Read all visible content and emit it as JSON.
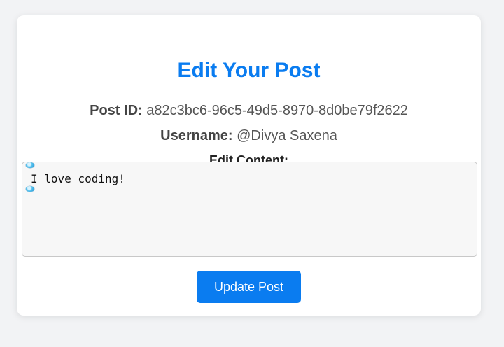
{
  "page": {
    "title": "Edit Your Post",
    "post_id_label": "Post ID:",
    "post_id": "a82c3bc6-96c5-49d5-8970-8d0be79f2622",
    "username_label": "Username:",
    "username": "@Divya Saxena",
    "edit_content_label": "Edit Content:",
    "content_value": "I love coding!",
    "update_button_label": "Update Post"
  },
  "colors": {
    "accent": "#0a7cf0",
    "background": "#f2f3f5",
    "card": "#ffffff",
    "textarea_bg": "#f7f7f7"
  },
  "icons": {
    "drag_handle_top": "resize-handle-icon",
    "drag_handle_bottom": "resize-handle-icon"
  }
}
